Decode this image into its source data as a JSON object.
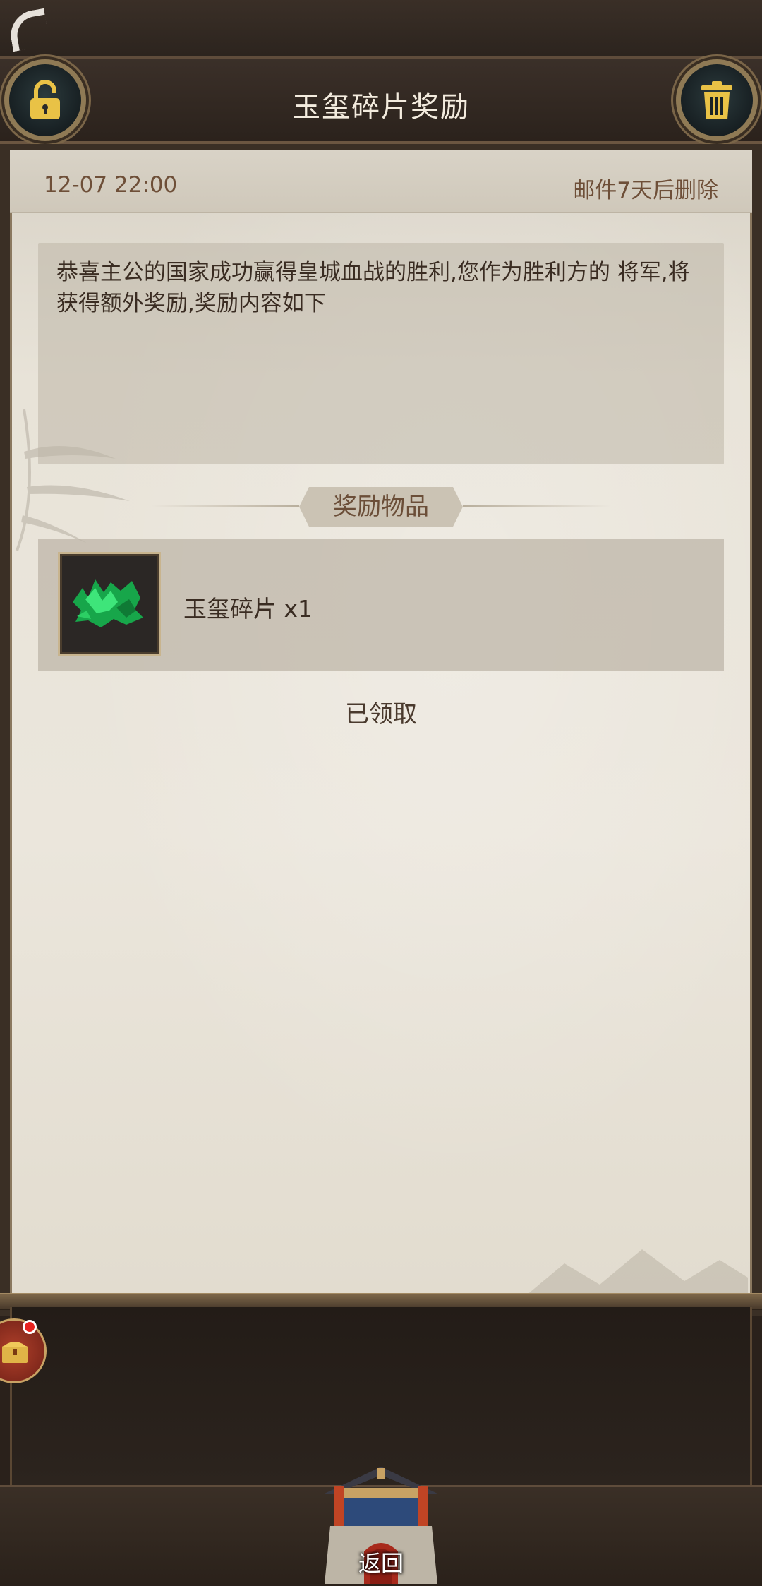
{
  "header": {
    "title": "玉玺碎片奖励"
  },
  "mail": {
    "date": "12-07 22:00",
    "expiry": "邮件7天后删除",
    "body": "恭喜主公的国家成功赢得皇城血战的胜利,您作为胜利方的 将军,将获得额外奖励,奖励内容如下",
    "rewards_label": "奖励物品",
    "reward_item": "玉玺碎片 x1",
    "status": "已领取"
  },
  "footer": {
    "return_label": "返回"
  },
  "icons": {
    "lock": "unlock-icon",
    "trash": "trash-icon",
    "chest": "treasure-chest-icon",
    "jade": "jade-shard-icon",
    "gate": "palace-gate-icon"
  },
  "colors": {
    "title_text": "#f3ebde",
    "accent_gold": "#d9b451",
    "paper": "#e8e3d8",
    "text_brown": "#6e4f38",
    "jade_green": "#22c55e",
    "notify_red": "#e8231f"
  }
}
